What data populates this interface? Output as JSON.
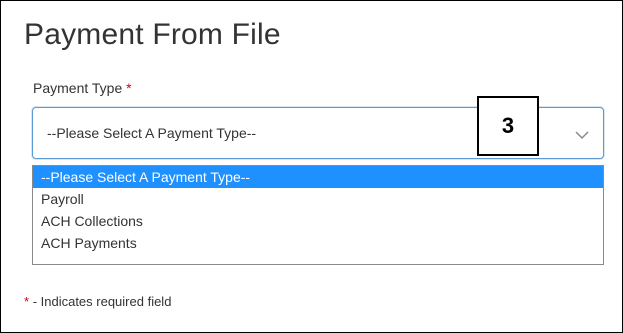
{
  "page": {
    "title": "Payment From File"
  },
  "form": {
    "payment_type_label": "Payment Type",
    "required_marker": "*",
    "select_value": "--Please Select A Payment Type--",
    "options": [
      "--Please Select A Payment Type--",
      "Payroll",
      "ACH Collections",
      "ACH Payments"
    ],
    "selected_option_index": 0
  },
  "annotation": {
    "step_number": "3"
  },
  "footer": {
    "required_marker": "*",
    "required_note": "- Indicates required field"
  },
  "colors": {
    "highlight": "#1e90ff",
    "required": "#d0021b",
    "focus_border": "#5b9bd5"
  }
}
